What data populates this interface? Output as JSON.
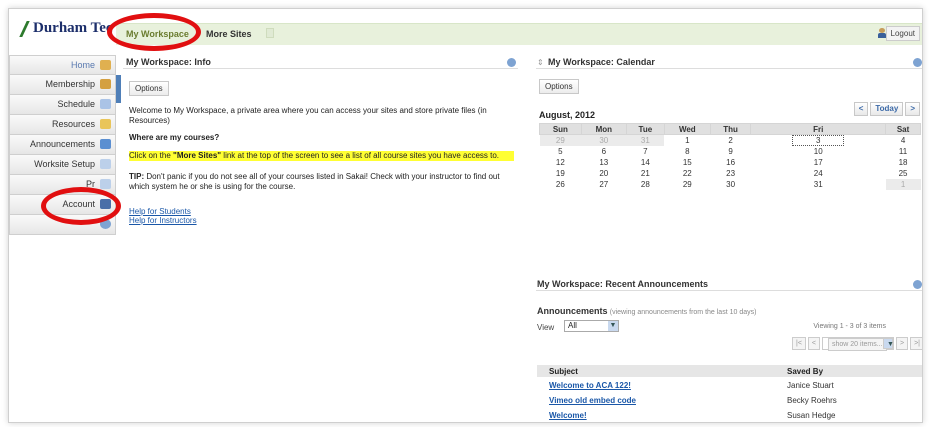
{
  "header": {
    "logo_text": "Durham Tec",
    "tabs": [
      "My Workspace",
      "More Sites"
    ],
    "logout_label": "Logout"
  },
  "tool_menu": [
    {
      "label": "Home",
      "icon": "house-icon",
      "color": "#e0b050"
    },
    {
      "label": "Membership",
      "icon": "members-icon",
      "color": "#d4a040"
    },
    {
      "label": "Schedule",
      "icon": "calendar-icon",
      "color": "#7aa0d4"
    },
    {
      "label": "Resources",
      "icon": "folder-icon",
      "color": "#e9c55a"
    },
    {
      "label": "Announcements",
      "icon": "megaphone-icon",
      "color": "#5b8fd1"
    },
    {
      "label": "Worksite Setup",
      "icon": "setup-icon",
      "color": "#9cb6d8"
    },
    {
      "label": "Pr",
      "icon": "prefs-icon",
      "color": "#9cb6d8"
    },
    {
      "label": "Account",
      "icon": "user-icon",
      "color": "#4a6fa8"
    },
    {
      "label": "",
      "icon": "help-icon",
      "color": "#7ea3d2"
    }
  ],
  "info": {
    "title": "My Workspace: Info",
    "options_label": "Options",
    "intro": "Welcome to My Workspace, a private area where you can access your sites and store private files (in Resources)",
    "where": "Where are my courses?",
    "highlight_pre": "Click on the ",
    "highlight_bold": "\"More Sites\"",
    "highlight_post": " link at the top of the screen to see a list of all course sites you have access to.",
    "tip_label": "TIP:",
    "tip": " Don't panic if you do not see all of your courses listed in Sakai! Check with your instructor to find out which system he or she is using for the course.",
    "link_students": "Help for Students",
    "link_instructors": "Help for Instructors"
  },
  "calendar": {
    "title": "My Workspace: Calendar",
    "options_label": "Options",
    "month": "August, 2012",
    "today_label": "Today",
    "prev": "<",
    "next": ">",
    "days": [
      "Sun",
      "Mon",
      "Tue",
      "Wed",
      "Thu",
      "Fri",
      "Sat"
    ],
    "weeks": [
      [
        {
          "d": "29",
          "o": true
        },
        {
          "d": "30",
          "o": true
        },
        {
          "d": "31",
          "o": true
        },
        {
          "d": "1"
        },
        {
          "d": "2"
        },
        {
          "d": "3",
          "today": true
        },
        {
          "d": "4"
        }
      ],
      [
        {
          "d": "5"
        },
        {
          "d": "6"
        },
        {
          "d": "7"
        },
        {
          "d": "8"
        },
        {
          "d": "9"
        },
        {
          "d": "10"
        },
        {
          "d": "11"
        }
      ],
      [
        {
          "d": "12"
        },
        {
          "d": "13"
        },
        {
          "d": "14"
        },
        {
          "d": "15"
        },
        {
          "d": "16"
        },
        {
          "d": "17"
        },
        {
          "d": "18"
        }
      ],
      [
        {
          "d": "19"
        },
        {
          "d": "20"
        },
        {
          "d": "21"
        },
        {
          "d": "22"
        },
        {
          "d": "23"
        },
        {
          "d": "24"
        },
        {
          "d": "25"
        }
      ],
      [
        {
          "d": "26"
        },
        {
          "d": "27"
        },
        {
          "d": "28"
        },
        {
          "d": "29"
        },
        {
          "d": "30"
        },
        {
          "d": "31"
        },
        {
          "d": "1",
          "o": true
        }
      ]
    ]
  },
  "announcements": {
    "title": "My Workspace: Recent Announcements",
    "heading": "Announcements",
    "note": "(viewing announcements from the last 10 days)",
    "view_label": "View",
    "view_value": "All",
    "count": "Viewing 1 - 3 of 3 items",
    "show_label": "show 20 items...",
    "pager_first": "|<",
    "pager_prev": "<",
    "pager_next": ">",
    "pager_last": ">|",
    "col_subject": "Subject",
    "col_saved_by": "Saved By",
    "rows": [
      {
        "subject": "Welcome to ACA 122!",
        "by": "Janice Stuart"
      },
      {
        "subject": "Vimeo old embed code",
        "by": "Becky Roehrs"
      },
      {
        "subject": "Welcome!",
        "by": "Susan Hedge"
      }
    ]
  },
  "accent_color": "#e10f10"
}
